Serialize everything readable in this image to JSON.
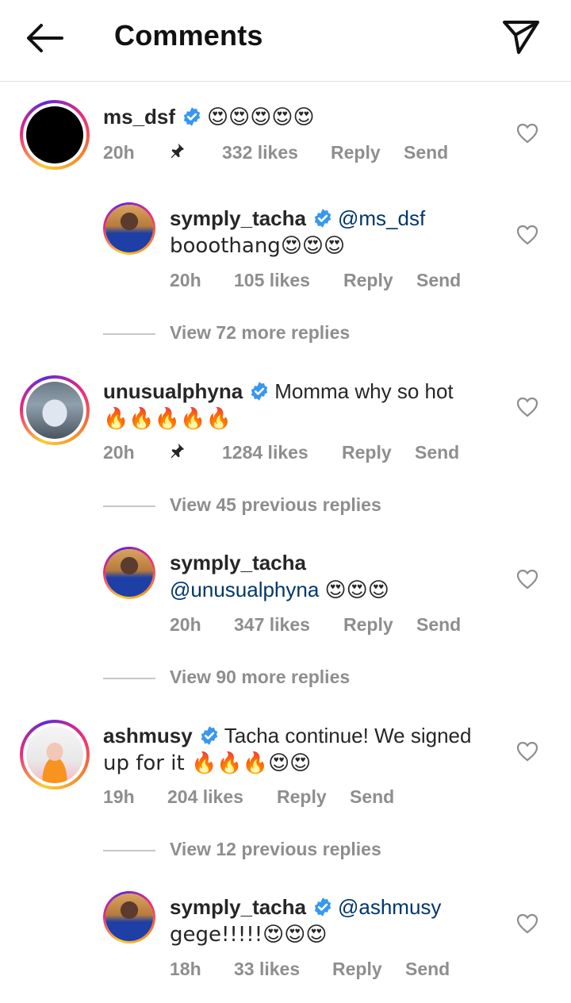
{
  "header": {
    "title": "Comments",
    "back_icon": "back-arrow-icon",
    "send_icon": "paper-plane-icon"
  },
  "actions": {
    "reply": "Reply",
    "send": "Send"
  },
  "comments": [
    {
      "username": "ms_dsf",
      "verified": true,
      "text": "😍😍😍😍😍",
      "time": "20h",
      "pinned": true,
      "likes": "332 likes"
    },
    {
      "username": "symply_tacha",
      "verified": true,
      "mention": "@ms_dsf",
      "text": "booothang😍😍😍",
      "time": "20h",
      "likes": "105 likes"
    },
    {
      "view_more": "View 72 more replies"
    },
    {
      "username": "unusualphyna",
      "verified": true,
      "text": "Momma why so hot",
      "text2": "🔥🔥🔥🔥🔥",
      "time": "20h",
      "pinned": true,
      "likes": "1284 likes"
    },
    {
      "view_previous": "View 45 previous replies"
    },
    {
      "username": "symply_tacha",
      "verified": false,
      "mention": "@unusualphyna",
      "text": "😍😍😍",
      "time": "20h",
      "likes": "347 likes"
    },
    {
      "view_more": "View 90 more replies"
    },
    {
      "username": "ashmusy",
      "verified": true,
      "text": "Tacha continue! We signed",
      "text2": "up for it 🔥🔥🔥😍😍",
      "time": "19h",
      "likes": "204 likes"
    },
    {
      "view_previous": "View 12 previous replies"
    },
    {
      "username": "symply_tacha",
      "verified": true,
      "mention": "@ashmusy",
      "text": "gege!!!!!😍😍😍",
      "time": "18h",
      "likes": "33 likes"
    }
  ],
  "colors": {
    "text": "#262626",
    "meta": "#8e8e8e",
    "mention": "#00376b",
    "verified": "#3897f0",
    "divider": "#e3e3e3"
  }
}
